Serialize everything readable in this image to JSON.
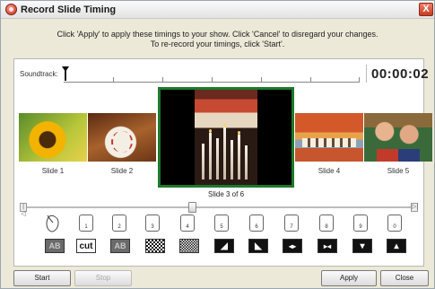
{
  "window": {
    "title": "Record Slide Timing",
    "close_glyph": "X"
  },
  "instructions": {
    "line1": "Click 'Apply' to apply these timings to your show. Click 'Cancel' to disregard your changes.",
    "line2": "To re-record your timings, click 'Start'."
  },
  "soundtrack": {
    "label": "Soundtrack:",
    "timer": "00:00:02"
  },
  "slides": [
    {
      "label": "Slide 1"
    },
    {
      "label": "Slide 2"
    },
    {
      "label": "Slide 4"
    },
    {
      "label": "Slide 5"
    }
  ],
  "current_slide": {
    "label": "Slide 3 of 6"
  },
  "slider": {
    "start_glyph": "|◁",
    "end_glyph": "▷|",
    "position_fraction": 0.43
  },
  "keys": [
    {
      "num": "1"
    },
    {
      "num": "2"
    },
    {
      "num": "3"
    },
    {
      "num": "4"
    },
    {
      "num": "5"
    },
    {
      "num": "6"
    },
    {
      "num": "7"
    },
    {
      "num": "8"
    },
    {
      "num": "9"
    },
    {
      "num": "0"
    }
  ],
  "effects": [
    {
      "icon": "ab-fade-icon",
      "text": "AB"
    },
    {
      "icon": "cut-icon",
      "text": "cut"
    },
    {
      "icon": "ab-dissolve-icon",
      "text": "AB"
    },
    {
      "icon": "checker-icon",
      "text": ""
    },
    {
      "icon": "checker-dense-icon",
      "text": ""
    },
    {
      "icon": "wipe-diagonal-icon",
      "text": "◢"
    },
    {
      "icon": "wipe-diagonal-reverse-icon",
      "text": "◣"
    },
    {
      "icon": "wipe-left-right-icon",
      "text": "◂▸"
    },
    {
      "icon": "wipe-right-left-icon",
      "text": "▸◂"
    },
    {
      "icon": "wipe-down-icon",
      "text": "▾"
    },
    {
      "icon": "wipe-up-icon",
      "text": "▴"
    }
  ],
  "buttons": {
    "start": "Start",
    "stop": "Stop",
    "apply": "Apply",
    "close": "Close"
  },
  "colors": {
    "current_slide_border": "#1d7a2a",
    "window_bg": "#ece9d8"
  }
}
